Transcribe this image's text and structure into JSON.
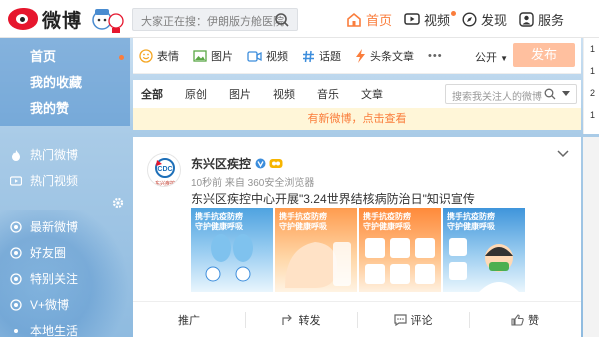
{
  "topnav": {
    "logo_text": "微博",
    "search_placeholder": "大家正在搜：伊朗版方舱医院",
    "links": [
      {
        "label": "首页",
        "icon": "home-icon"
      },
      {
        "label": "视频",
        "icon": "video-icon"
      },
      {
        "label": "发现",
        "icon": "compass-icon"
      },
      {
        "label": "服务",
        "icon": "user-icon"
      }
    ]
  },
  "leftnav": {
    "primary": [
      "首页",
      "我的收藏",
      "我的赞"
    ],
    "hot": [
      "热门微博",
      "热门视频"
    ],
    "groups": [
      "最新微博",
      "好友圈",
      "特别关注",
      "V+微博",
      "本地生活"
    ]
  },
  "composer": {
    "tools": [
      "表情",
      "图片",
      "视频",
      "话题",
      "头条文章"
    ],
    "more": "•••",
    "visibility": "公开",
    "publish_label": "发布"
  },
  "filter": {
    "tabs": [
      "全部",
      "原创",
      "图片",
      "视频",
      "音乐",
      "文章"
    ],
    "search_placeholder": "搜索我关注人的微博"
  },
  "new_tip": "有新微博，点击查看",
  "post": {
    "author": "东兴区疾控",
    "meta": "10秒前 来自 360安全浏览器",
    "text": "东兴区疾控中心开展\"3.24世界结核病防治日\"知识宣传",
    "avatar_caption": "东兴疾控",
    "image_headers": [
      "携手抗疫防痨\n守护健康呼吸",
      "携手抗疫防痨\n守护健康呼吸",
      "携手抗疫防痨\n守护健康呼吸",
      "携手抗疫防痨\n守护健康呼吸"
    ],
    "actions": [
      "推广",
      "转发",
      "评论",
      "赞"
    ]
  },
  "rightpanel": {
    "items": [
      "1",
      "1",
      "2",
      "1"
    ]
  },
  "colors": {
    "accent": "#fa7d3c",
    "publish_btn": "#ffc09f",
    "tip_bg": "#fff6d8",
    "weibo_red": "#e6162d"
  }
}
